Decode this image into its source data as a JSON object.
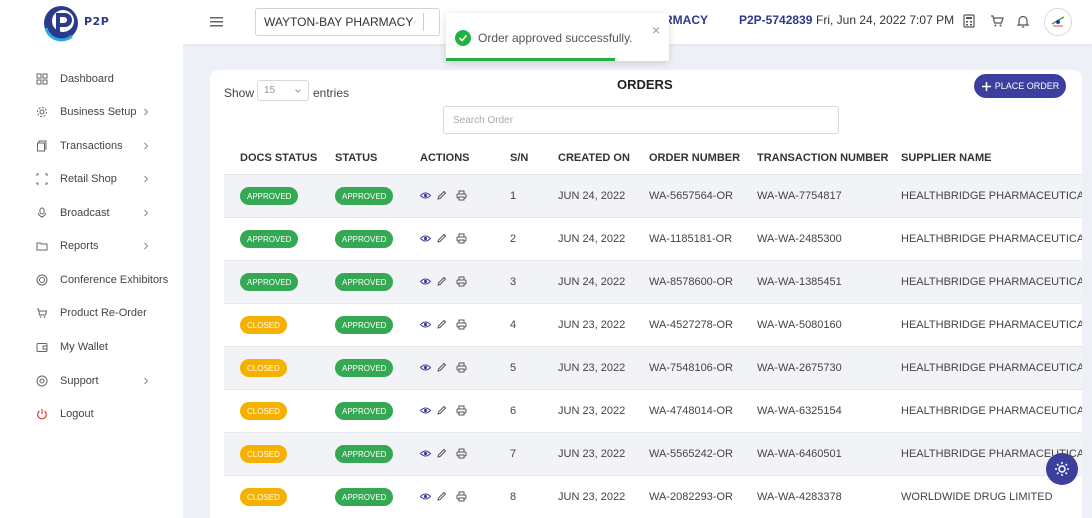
{
  "header": {
    "logo_text": "P2P",
    "pharmacy": "WAYTON-BAY PHARMACY",
    "pharmacy_tail": "RMACY",
    "code": "P2P-5742839",
    "datetime": "Fri, Jun 24, 2022 7:07 PM",
    "icons": [
      "calculator-icon",
      "cart-icon",
      "bell-icon"
    ]
  },
  "toast": {
    "message": "Order approved successfully.",
    "close": "×",
    "progress": 0.76,
    "accent": "#1fb141"
  },
  "sidebar": {
    "items": [
      {
        "label": "Dashboard",
        "icon": "dashboard-icon",
        "has_children": false
      },
      {
        "label": "Business Setup",
        "icon": "gear-icon",
        "has_children": true
      },
      {
        "label": "Transactions",
        "icon": "copy-icon",
        "has_children": true
      },
      {
        "label": "Retail Shop",
        "icon": "frame-icon",
        "has_children": true
      },
      {
        "label": "Broadcast",
        "icon": "microphone-icon",
        "has_children": true
      },
      {
        "label": "Reports",
        "icon": "folder-icon",
        "has_children": true
      },
      {
        "label": "Conference Exhibitors",
        "icon": "target-icon",
        "has_children": false
      },
      {
        "label": "Product Re-Order",
        "icon": "cart-icon",
        "has_children": false
      },
      {
        "label": "My Wallet",
        "icon": "wallet-icon",
        "has_children": false
      },
      {
        "label": "Support",
        "icon": "support-icon",
        "has_children": true
      },
      {
        "label": "Logout",
        "icon": "power-icon",
        "has_children": false
      }
    ]
  },
  "main": {
    "title": "ORDERS",
    "show_label": "Show",
    "entries_value": "15",
    "entries_label": "entries",
    "place_order": "PLACE ORDER",
    "search_placeholder": "Search Order",
    "columns": [
      "DOCS STATUS",
      "STATUS",
      "ACTIONS",
      "S/N",
      "CREATED ON",
      "ORDER NUMBER",
      "TRANSACTION NUMBER",
      "SUPPLIER NAME"
    ],
    "rows": [
      {
        "docs_status": "APPROVED",
        "status": "APPROVED",
        "sn": "1",
        "created_on": "JUN 24, 2022",
        "order_number": "WA-5657564-OR",
        "transaction_number": "WA-WA-7754817",
        "supplier": "HEALTHBRIDGE PHARMACEUTICALS"
      },
      {
        "docs_status": "APPROVED",
        "status": "APPROVED",
        "sn": "2",
        "created_on": "JUN 24, 2022",
        "order_number": "WA-1185181-OR",
        "transaction_number": "WA-WA-2485300",
        "supplier": "HEALTHBRIDGE PHARMACEUTICALS"
      },
      {
        "docs_status": "APPROVED",
        "status": "APPROVED",
        "sn": "3",
        "created_on": "JUN 24, 2022",
        "order_number": "WA-8578600-OR",
        "transaction_number": "WA-WA-1385451",
        "supplier": "HEALTHBRIDGE PHARMACEUTICALS"
      },
      {
        "docs_status": "CLOSED",
        "status": "APPROVED",
        "sn": "4",
        "created_on": "JUN 23, 2022",
        "order_number": "WA-4527278-OR",
        "transaction_number": "WA-WA-5080160",
        "supplier": "HEALTHBRIDGE PHARMACEUTICALS"
      },
      {
        "docs_status": "CLOSED",
        "status": "APPROVED",
        "sn": "5",
        "created_on": "JUN 23, 2022",
        "order_number": "WA-7548106-OR",
        "transaction_number": "WA-WA-2675730",
        "supplier": "HEALTHBRIDGE PHARMACEUTICALS"
      },
      {
        "docs_status": "CLOSED",
        "status": "APPROVED",
        "sn": "6",
        "created_on": "JUN 23, 2022",
        "order_number": "WA-4748014-OR",
        "transaction_number": "WA-WA-6325154",
        "supplier": "HEALTHBRIDGE PHARMACEUTICALS"
      },
      {
        "docs_status": "CLOSED",
        "status": "APPROVED",
        "sn": "7",
        "created_on": "JUN 23, 2022",
        "order_number": "WA-5565242-OR",
        "transaction_number": "WA-WA-6460501",
        "supplier": "HEALTHBRIDGE PHARMACEUTICALS"
      },
      {
        "docs_status": "CLOSED",
        "status": "APPROVED",
        "sn": "8",
        "created_on": "JUN 23, 2022",
        "order_number": "WA-2082293-OR",
        "transaction_number": "WA-WA-4283378",
        "supplier": "WORLDWIDE DRUG LIMITED"
      }
    ]
  },
  "colors": {
    "brand": "#3d3f9e",
    "approved": "#34a853",
    "closed": "#f6b100"
  }
}
